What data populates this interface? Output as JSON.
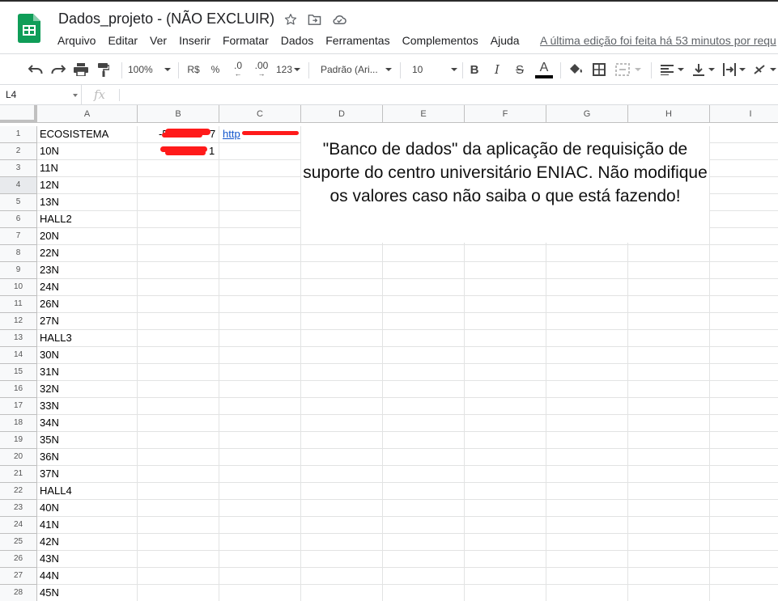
{
  "app": {
    "title": "Dados_projeto - (NÃO EXCLUIR)",
    "logo": "google-sheets-logo",
    "title_icons": [
      "star-icon",
      "move-to-folder-icon",
      "cloud-saved-icon"
    ]
  },
  "menu": {
    "items": [
      "Arquivo",
      "Editar",
      "Ver",
      "Inserir",
      "Formatar",
      "Dados",
      "Ferramentas",
      "Complementos",
      "Ajuda"
    ],
    "last_edit": "A última edição foi feita há 53 minutos por requ"
  },
  "toolbar": {
    "zoom": "100%",
    "currency": "R$",
    "percent": "%",
    "decrease_decimals": ".0",
    "increase_decimals": ".00",
    "more_formats": "123",
    "font": "Padrão (Ari...",
    "font_size": "10",
    "bold": "B",
    "italic": "I",
    "strikethrough": "S",
    "text_color_letter": "A",
    "accent_color": "#0f9d58",
    "text_color_bar": "#000000"
  },
  "formula_bar": {
    "name_box": "L4",
    "fx_label": "fx",
    "value": ""
  },
  "grid": {
    "columns": [
      "A",
      "B",
      "C",
      "D",
      "E",
      "F",
      "G",
      "H",
      "I"
    ],
    "rows": [
      "1",
      "2",
      "3",
      "4",
      "5",
      "6",
      "7",
      "8",
      "9",
      "10",
      "11",
      "12",
      "13",
      "14",
      "15",
      "16",
      "17",
      "18",
      "19",
      "20",
      "21",
      "22",
      "23",
      "24",
      "25",
      "26",
      "27",
      "28"
    ],
    "selected_row": "4",
    "column_a": [
      "ECOSISTEMA",
      "10N",
      "11N",
      "12N",
      "13N",
      "HALL2",
      "20N",
      "22N",
      "23N",
      "24N",
      "26N",
      "27N",
      "HALL3",
      "30N",
      "31N",
      "32N",
      "33N",
      "34N",
      "35N",
      "36N",
      "37N",
      "HALL4",
      "40N",
      "41N",
      "42N",
      "43N",
      "44N",
      "45N"
    ],
    "b1_visible": "-5",
    "b1_tail": "7",
    "b2_tail": "1",
    "c1_visible": "http",
    "redaction_color": "#ff1a1a"
  },
  "note": {
    "text": "\"Banco de dados\" da aplicação de requisição de suporte do centro universitário ENIAC. Não modifique os valores caso não saiba o que está fazendo!"
  }
}
